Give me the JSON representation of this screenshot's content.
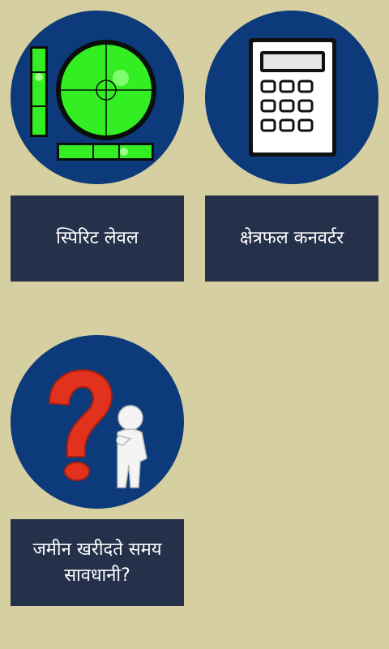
{
  "tiles": [
    {
      "label": "स्पिरिट लेवल",
      "icon": "spirit-level-icon"
    },
    {
      "label": "क्षेत्रफल कनवर्टर",
      "icon": "calculator-icon"
    },
    {
      "label": "जमीन खरीदते समय सावधानी?",
      "icon": "question-person-icon"
    }
  ],
  "colors": {
    "background": "#d6cfa1",
    "circle": "#0c3a7a",
    "button": "#25304a",
    "button_text": "#ffffff",
    "level_green": "#33ee22",
    "question_red": "#e2321e"
  }
}
